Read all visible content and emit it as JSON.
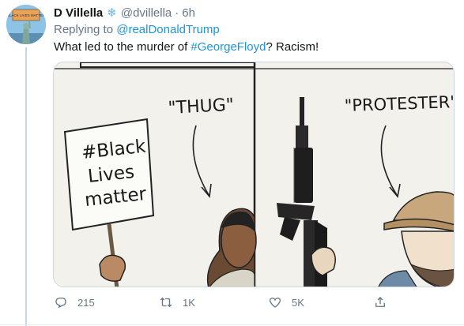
{
  "tweet": {
    "author_name": "D Villella",
    "handle": "@dvillella",
    "separator": "·",
    "time": "6h",
    "replying_to_prefix": "Replying to",
    "replying_to_handle": "@realDonaldTrump",
    "text_before": "What led to the murder of ",
    "hashtag": "#GeorgeFloyd",
    "text_after": "? Racism!",
    "avatar_sign_text": "BLACK LIVES MATTER"
  },
  "cartoon": {
    "left_caption": "\"THUG\"",
    "right_caption": "\"PROTESTER\"",
    "sign_line1": "#Black",
    "sign_line2": "Lives",
    "sign_line3": "matter"
  },
  "actions": {
    "replies": "215",
    "retweets": "1K",
    "likes": "5K"
  },
  "colors": {
    "link": "#1b95e0",
    "muted": "#657786",
    "text": "#14171a",
    "verified_flake": "#64b5f6"
  },
  "icons": {
    "reply": "reply-icon",
    "retweet": "retweet-icon",
    "like": "heart-icon",
    "share": "share-icon",
    "snowflake": "snowflake-icon"
  }
}
